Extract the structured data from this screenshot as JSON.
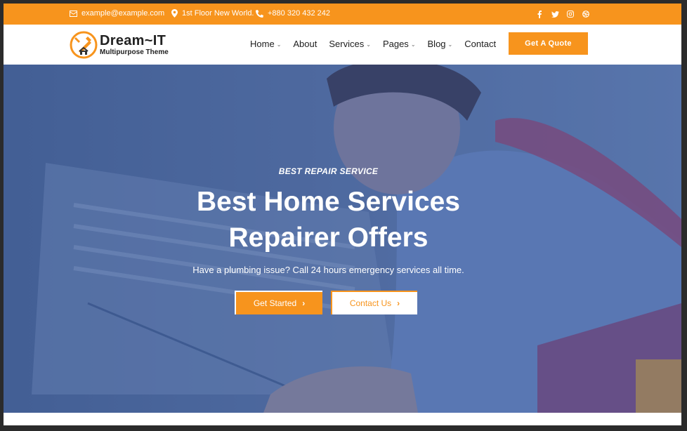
{
  "topbar": {
    "email": "example@example.com",
    "address": "1st Floor New World.",
    "phone": "+880 320 432 242",
    "social": [
      "facebook-icon",
      "twitter-icon",
      "instagram-icon",
      "dribbble-icon"
    ]
  },
  "logo": {
    "name": "Dream~IT",
    "tagline": "Multipurpose Theme"
  },
  "nav": {
    "items": [
      {
        "label": "Home",
        "dropdown": true
      },
      {
        "label": "About",
        "dropdown": false
      },
      {
        "label": "Services",
        "dropdown": true
      },
      {
        "label": "Pages",
        "dropdown": true
      },
      {
        "label": "Blog",
        "dropdown": true
      },
      {
        "label": "Contact",
        "dropdown": false
      }
    ],
    "cta": "Get A Quote"
  },
  "hero": {
    "eyebrow": "BEST REPAIR SERVICE",
    "title_line1": "Best Home Services",
    "title_line2": "Repairer Offers",
    "subtitle": "Have a plumbing issue? Call 24 hours emergency services all time.",
    "primary_button": "Get Started",
    "secondary_button": "Contact Us"
  },
  "colors": {
    "accent": "#f7941d",
    "hero_overlay": "#3a5896"
  }
}
